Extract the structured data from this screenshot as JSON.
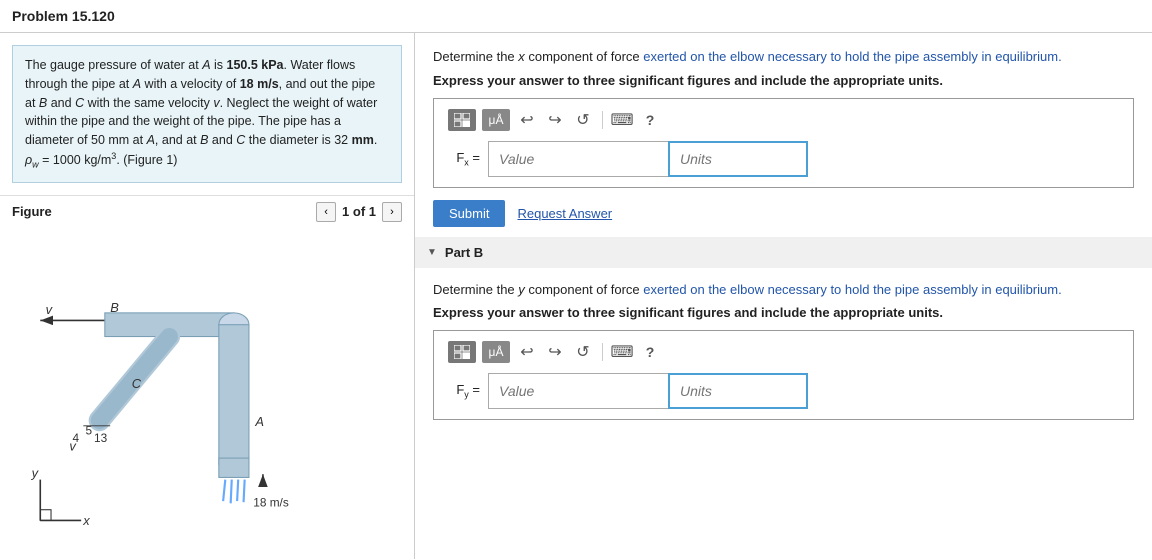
{
  "page": {
    "title": "Problem 15.120"
  },
  "left": {
    "problem_text_lines": [
      "The gauge pressure of water at A is 150.5 kPa. Water flows",
      "through the pipe at A with a velocity of 18 m/s, and out the",
      "pipe at B and C with the same velocity v. Neglect the weight",
      "of water within the pipe and the weight of the pipe. The pipe",
      "has a diameter of 50 mm at A, and at B and C the diameter",
      "is 32 mm. ρ_w = 1000 kg/m³. (Figure 1)"
    ],
    "figure_label": "Figure",
    "figure_nav": "1 of 1",
    "figure_labels": {
      "v_top": "v",
      "B": "B",
      "C": "C",
      "A": "A",
      "v_bottom": "v",
      "y_axis": "y",
      "x_axis": "x",
      "velocity_label": "18 m/s",
      "slope_label_5": "5",
      "slope_label_13": "13",
      "slope_label_4": "4"
    }
  },
  "right": {
    "part_a": {
      "question": "Determine the x component of force exerted on the elbow necessary to hold the pipe assembly in equilibrium.",
      "instruction": "Express your answer to three significant figures and include the appropriate units.",
      "label": "Fx =",
      "value_placeholder": "Value",
      "units_placeholder": "Units",
      "submit_label": "Submit",
      "request_label": "Request Answer",
      "toolbar": {
        "grid_icon": "⊞",
        "mu_icon": "μÅ",
        "undo_icon": "↩",
        "redo_icon": "↪",
        "refresh_icon": "↺",
        "keyboard_icon": "⌨",
        "help_icon": "?"
      }
    },
    "part_b": {
      "header": "Part B",
      "question": "Determine the y component of force exerted on the elbow necessary to hold the pipe assembly in equilibrium.",
      "instruction": "Express your answer to three significant figures and include the appropriate units.",
      "label": "Fy =",
      "value_placeholder": "Value",
      "units_placeholder": "Units",
      "toolbar": {
        "grid_icon": "⊞",
        "mu_icon": "μÅ",
        "undo_icon": "↩",
        "redo_icon": "↪",
        "refresh_icon": "↺",
        "keyboard_icon": "⌨",
        "help_icon": "?"
      }
    }
  }
}
